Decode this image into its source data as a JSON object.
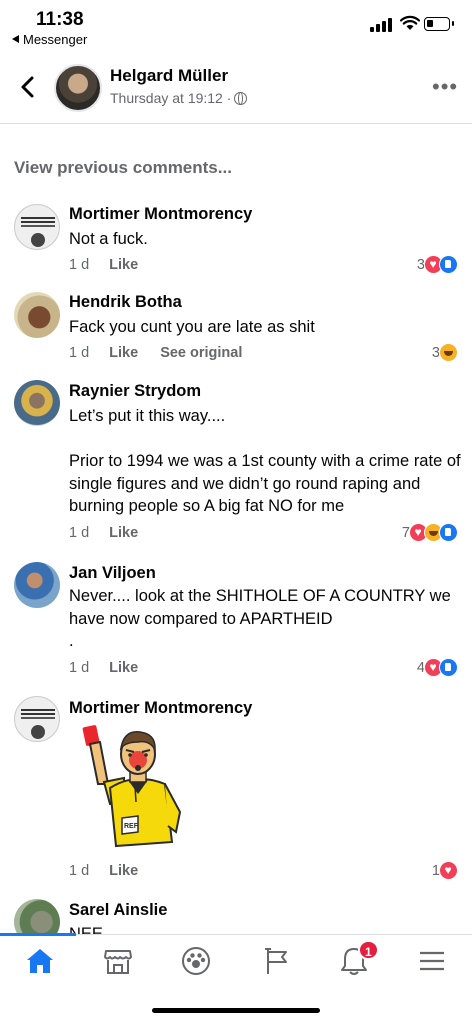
{
  "status_bar": {
    "time": "11:38",
    "back_app": "Messenger"
  },
  "header": {
    "name": "Helgard Müller",
    "timestamp": "Thursday at 19:12 ·",
    "more": "•••"
  },
  "view_previous": "View previous comments...",
  "comments": [
    {
      "name": "Mortimer Montmorency",
      "text": "Not a fuck.",
      "age": "1 d",
      "like": "Like",
      "reaction_count": "3",
      "reactions": [
        "love",
        "like"
      ]
    },
    {
      "name": "Hendrik Botha",
      "text": "Fack you cunt you are late as shit",
      "age": "1 d",
      "like": "Like",
      "see_original": "See original",
      "reaction_count": "3",
      "reactions": [
        "haha"
      ]
    },
    {
      "name": "Raynier Strydom",
      "text": "Let’s put it this way....\n\nPrior to 1994 we was a 1st county with a crime rate of single figures and we didn’t go round raping and burning people so A big fat NO for me",
      "age": "1 d",
      "like": "Like",
      "reaction_count": "7",
      "reactions": [
        "love",
        "haha",
        "like"
      ]
    },
    {
      "name": "Jan Viljoen",
      "text": "Never.... look at the SHITHOLE OF A COUNTRY we have now compared to APARTHEID\n.",
      "age": "1 d",
      "like": "Like",
      "reaction_count": "4",
      "reactions": [
        "love",
        "like"
      ]
    },
    {
      "name": "Mortimer Montmorency",
      "sticker": "referee-red-card-sticker",
      "sticker_badge": "REF",
      "age": "1 d",
      "like": "Like",
      "reaction_count": "1",
      "reactions": [
        "love"
      ]
    },
    {
      "name": "Sarel Ainslie",
      "text": "NEE"
    }
  ],
  "bottom_nav": {
    "items": [
      "home-icon",
      "marketplace-icon",
      "groups-icon",
      "pages-flag-icon",
      "notifications-bell-icon",
      "menu-icon"
    ],
    "notification_badge": "1",
    "accent": "#1877f2"
  }
}
